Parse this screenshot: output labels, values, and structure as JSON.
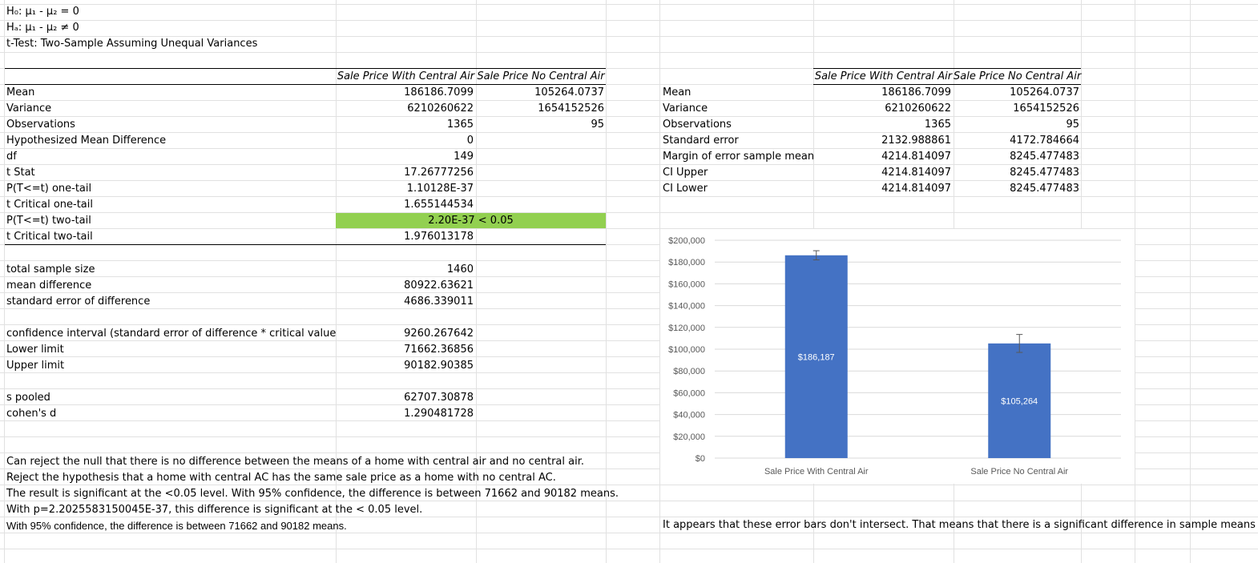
{
  "hypotheses": {
    "h0": "H₀: μ₁ - μ₂ = 0",
    "ha": "Hₐ: μ₁ - μ₂ ≠ 0",
    "test_title": "t-Test: Two-Sample Assuming Unequal Variances"
  },
  "ttest": {
    "col1_header": "Sale Price With Central Air",
    "col2_header": "Sale Price No Central Air",
    "rows": [
      {
        "label": "Mean",
        "v1": "186186.7099",
        "v2": "105264.0737"
      },
      {
        "label": "Variance",
        "v1": "6210260622",
        "v2": "1654152526"
      },
      {
        "label": "Observations",
        "v1": "1365",
        "v2": "95"
      },
      {
        "label": "Hypothesized Mean Difference",
        "v1": "0",
        "v2": ""
      },
      {
        "label": "df",
        "v1": "149",
        "v2": ""
      },
      {
        "label": "t Stat",
        "v1": "17.26777256",
        "v2": ""
      },
      {
        "label": "P(T<=t) one-tail",
        "v1": "1.10128E-37",
        "v2": ""
      },
      {
        "label": "t Critical one-tail",
        "v1": "1.655144534",
        "v2": ""
      },
      {
        "label": "P(T<=t) two-tail",
        "v1": "2.20E-37 < 0.05",
        "v2": ""
      },
      {
        "label": "t Critical two-tail",
        "v1": "1.976013178",
        "v2": ""
      }
    ]
  },
  "extra": {
    "rows": [
      {
        "label": "total sample size",
        "value": "1460"
      },
      {
        "label": "mean difference",
        "value": "80922.63621"
      },
      {
        "label": "standard error of difference",
        "value": "4686.339011"
      },
      {
        "label": "confidence interval (standard error of difference * critical value",
        "value": "9260.267642"
      },
      {
        "label": "Lower limit",
        "value": "71662.36856"
      },
      {
        "label": "Upper limit",
        "value": "90182.90385"
      },
      {
        "label": "s pooled",
        "value": "62707.30878"
      },
      {
        "label": "cohen's d",
        "value": "1.290481728"
      }
    ]
  },
  "conclusions": [
    "Can reject the null that there is no difference between the means of a home with central air and no central air.",
    "Reject the hypothesis that a home with central AC has the same sale price as a home with no central AC.",
    "The result is significant at the <0.05 level. With 95% confidence, the difference is between 71662 and 90182 means.",
    "With p=2.2025583150045E-37, this difference is significant at the < 0.05 level.",
    "With 95% confidence, the difference is between 71662 and 90182 means."
  ],
  "ci_table": {
    "col1_header": "Sale Price With Central Air",
    "col2_header": "Sale Price No Central Air",
    "rows": [
      {
        "label": "Mean",
        "v1": "186186.7099",
        "v2": "105264.0737"
      },
      {
        "label": "Variance",
        "v1": "6210260622",
        "v2": "1654152526"
      },
      {
        "label": "Observations",
        "v1": "1365",
        "v2": "95"
      },
      {
        "label": "Standard error",
        "v1": "2132.988861",
        "v2": "4172.784664"
      },
      {
        "label": "Margin of error sample mean",
        "v1": "4214.814097",
        "v2": "8245.477483"
      },
      {
        "label": "CI Upper",
        "v1": "4214.814097",
        "v2": "8245.477483"
      },
      {
        "label": "CI Lower",
        "v1": "4214.814097",
        "v2": "8245.477483"
      }
    ]
  },
  "error_bar_note": "It appears that these error bars don't intersect. That means that there is a significant difference in sample means",
  "colors": {
    "bar": "#4472c4",
    "highlight": "#92d050",
    "gridline": "#d9d9d9",
    "axis_text": "#595959"
  },
  "chart_data": {
    "type": "bar",
    "categories": [
      "Sale Price With Central Air",
      "Sale Price No Central Air"
    ],
    "values": [
      186186.7099,
      105264.0737
    ],
    "data_labels": [
      "$186,187",
      "$105,264"
    ],
    "error_bars": [
      4214.814097,
      8245.477483
    ],
    "ylim": [
      0,
      200000
    ],
    "yticks": [
      0,
      20000,
      40000,
      60000,
      80000,
      100000,
      120000,
      140000,
      160000,
      180000,
      200000
    ],
    "ytick_labels": [
      "$0",
      "$20,000",
      "$40,000",
      "$60,000",
      "$80,000",
      "$100,000",
      "$120,000",
      "$140,000",
      "$160,000",
      "$180,000",
      "$200,000"
    ],
    "grid": true,
    "legend": "none"
  }
}
